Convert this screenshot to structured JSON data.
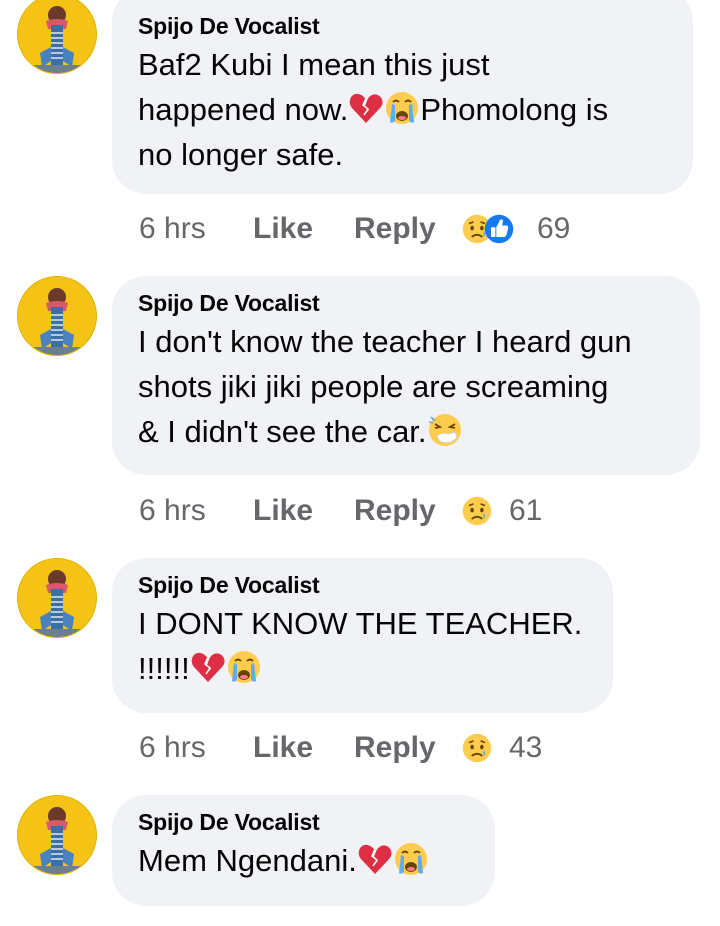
{
  "comments": [
    {
      "author": "Spijo De Vocalist",
      "text_lines": [
        "Baf2 Kubi I mean this just",
        "happened now.",
        "Phomolong is",
        "no longer safe."
      ],
      "time": "6 hrs",
      "like_label": "Like",
      "reply_label": "Reply",
      "reaction_count": "69",
      "reactions": [
        "sad-face-icon",
        "thumbs-up-icon"
      ]
    },
    {
      "author": "Spijo De Vocalist",
      "text_lines": [
        "I don't know the teacher I heard gun",
        "shots jiki jiki people are screaming",
        "& I didn't see the car."
      ],
      "time": "6 hrs",
      "like_label": "Like",
      "reply_label": "Reply",
      "reaction_count": "61",
      "reactions": [
        "sad-face-icon"
      ]
    },
    {
      "author": "Spijo De Vocalist",
      "text_lines": [
        "I DONT KNOW THE TEACHER.",
        "!!!!!!"
      ],
      "time": "6 hrs",
      "like_label": "Like",
      "reply_label": "Reply",
      "reaction_count": "43",
      "reactions": [
        "sad-face-icon"
      ]
    },
    {
      "author": "Spijo De Vocalist",
      "text_lines": [
        "Mem Ngendani."
      ],
      "time": "",
      "like_label": "",
      "reply_label": "",
      "reaction_count": "",
      "reactions": []
    }
  ],
  "colors": {
    "bubble": "#f0f2f5",
    "meta_text": "#65676b",
    "like_blue": "#1877f2",
    "avatar_yellow": "#f4c316"
  }
}
